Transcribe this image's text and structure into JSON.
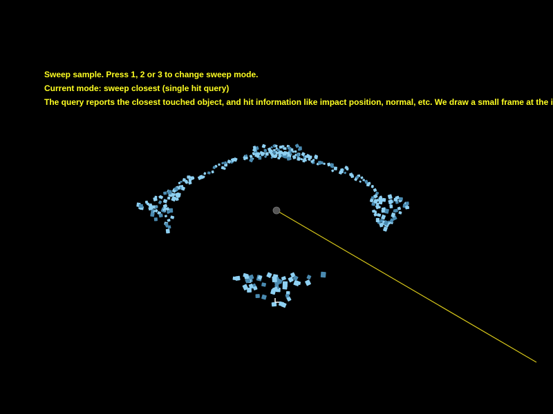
{
  "hud": {
    "text_color": "#ffff22",
    "lines": [
      "Sweep sample. Press 1, 2 or 3 to change sweep mode.",
      "Current mode: sweep closest (single hit query)",
      "The query reports the closest touched object, and hit information like impact position, normal, etc. We draw a small frame at the impact po"
    ]
  },
  "scene": {
    "background_color": "#000000",
    "object_color": "#8ed0f2",
    "object_shadow_color": "#4a8ab0",
    "sweep_line_color": "#d8c81a",
    "sweep_origin_color": "#555555",
    "hit_frame_color": "#ffffff"
  }
}
